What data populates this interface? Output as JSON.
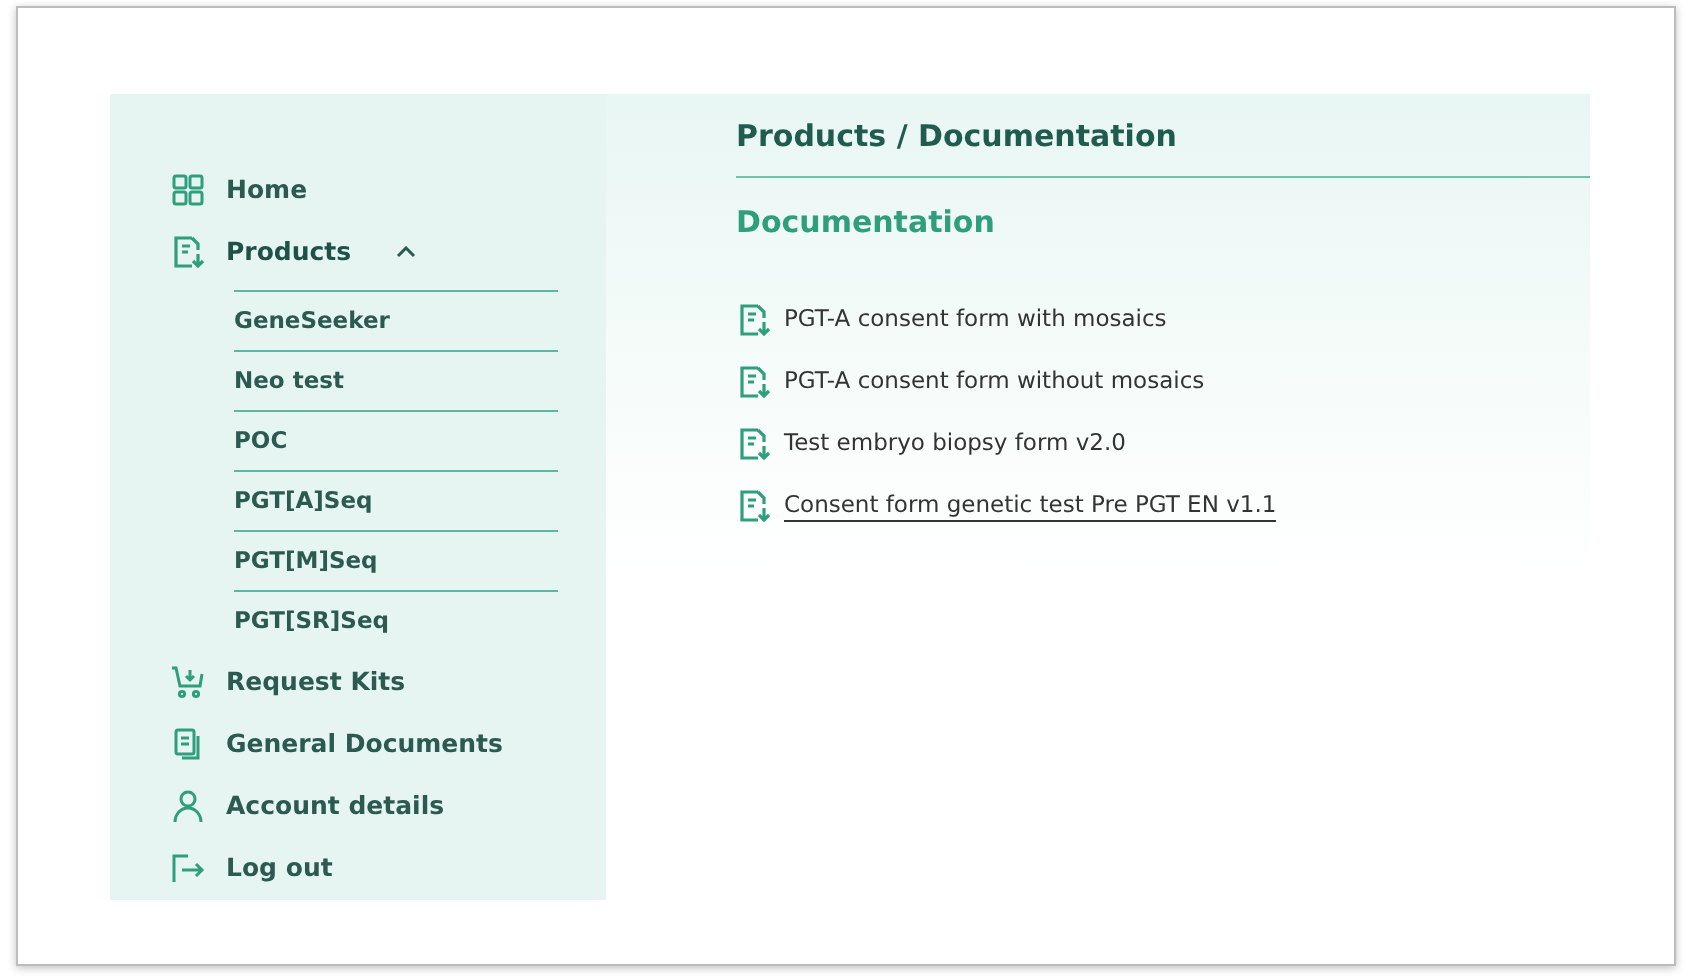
{
  "sidebar": {
    "items": [
      {
        "label": "Home",
        "selected": false
      },
      {
        "label": "Products",
        "selected": true,
        "expanded": true,
        "children": [
          {
            "label": "GeneSeeker"
          },
          {
            "label": "Neo test"
          },
          {
            "label": "POC"
          },
          {
            "label": "PGT[A]Seq"
          },
          {
            "label": "PGT[M]Seq"
          },
          {
            "label": "PGT[SR]Seq"
          }
        ]
      },
      {
        "label": "Request Kits",
        "selected": false
      },
      {
        "label": "General Documents",
        "selected": false
      },
      {
        "label": "Account details",
        "selected": false
      },
      {
        "label": "Log out",
        "selected": false
      }
    ]
  },
  "main": {
    "breadcrumb": "Products / Documentation",
    "heading": "Documentation",
    "documents": [
      {
        "label": "PGT-A consent form with mosaics",
        "hovered": false
      },
      {
        "label": "PGT-A consent form without mosaics",
        "hovered": false
      },
      {
        "label": "Test embryo biopsy form v2.0",
        "hovered": false
      },
      {
        "label": "Consent form genetic test Pre PGT EN v1.1",
        "hovered": true
      }
    ]
  }
}
